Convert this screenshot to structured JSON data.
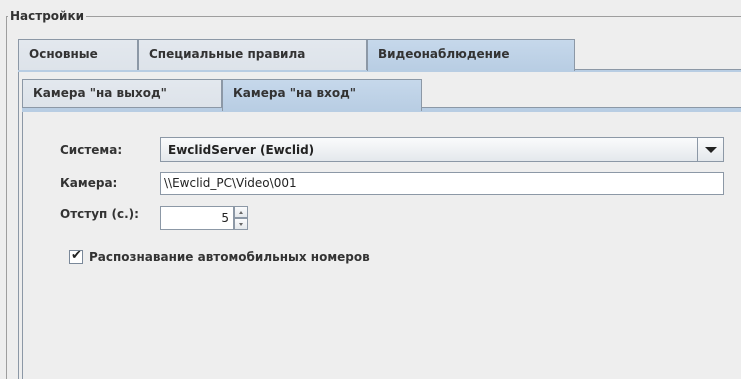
{
  "group": {
    "title": "Настройки"
  },
  "outer_tabs": [
    {
      "label": "Основные",
      "active": false
    },
    {
      "label": "Специальные правила",
      "active": false
    },
    {
      "label": "Видеонаблюдение",
      "active": true
    }
  ],
  "inner_tabs": [
    {
      "label": "Камера \"на выход\"",
      "active": false
    },
    {
      "label": "Камера \"на вход\"",
      "active": true
    }
  ],
  "form": {
    "system_label": "Система:",
    "system_value": "EwclidServer (Ewclid)",
    "camera_label": "Камера:",
    "camera_value": "\\\\Ewclid_PC\\Video\\001",
    "offset_label": "Отступ (с.):",
    "offset_value": "5",
    "plate_recognition_label": "Распознавание автомобильных номеров",
    "plate_recognition_checked": true,
    "check_glyph": "✔"
  },
  "icons": {
    "combo_arrow": "chevron-down-icon",
    "spinner_up": "caret-up-icon",
    "spinner_down": "caret-down-icon",
    "checkmark": "checkmark-icon"
  },
  "colors": {
    "background": "#eeeeee",
    "active_tab": "#b8cde3",
    "border": "#8c98a6"
  }
}
